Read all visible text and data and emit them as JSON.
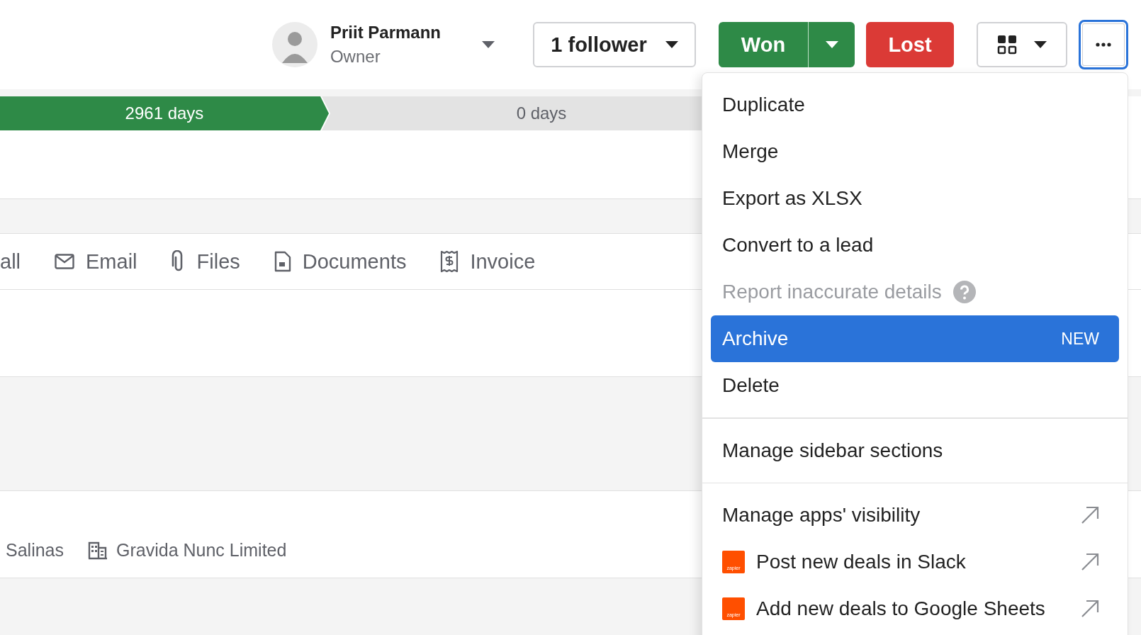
{
  "owner": {
    "name": "Priit Parmann",
    "role": "Owner"
  },
  "follower_button": "1 follower",
  "won_button": "Won",
  "lost_button": "Lost",
  "stages": [
    {
      "label": "2961 days",
      "selected": true
    },
    {
      "label": "0 days",
      "selected": false
    }
  ],
  "tabs": [
    {
      "label": "all"
    },
    {
      "label": "Email"
    },
    {
      "label": "Files"
    },
    {
      "label": "Documents"
    },
    {
      "label": "Invoice"
    }
  ],
  "info": [
    {
      "label": "Salinas"
    },
    {
      "label": "Gravida Nunc Limited"
    }
  ],
  "menu": [
    [
      {
        "label": "Duplicate",
        "selected": false,
        "disabled": false
      },
      {
        "label": "Merge",
        "selected": false,
        "disabled": false
      },
      {
        "label": "Export as XLSX",
        "selected": false,
        "disabled": false
      },
      {
        "label": "Convert to a lead",
        "selected": false,
        "disabled": false
      },
      {
        "label": "Report inaccurate details",
        "selected": false,
        "disabled": true,
        "help": true
      },
      {
        "label": "Archive",
        "selected": true,
        "disabled": false,
        "badge": "NEW"
      },
      {
        "label": "Delete",
        "selected": false,
        "disabled": false
      }
    ],
    [
      {
        "label": "Manage sidebar sections",
        "selected": false,
        "disabled": false
      }
    ],
    [
      {
        "label": "Manage apps' visibility",
        "selected": false,
        "disabled": false,
        "external": true
      },
      {
        "label": "Post new deals in Slack",
        "selected": false,
        "disabled": false,
        "external": true,
        "app": "zapier"
      },
      {
        "label": "Add new deals to Google Sheets",
        "selected": false,
        "disabled": false,
        "external": true,
        "app": "zapier"
      }
    ]
  ]
}
